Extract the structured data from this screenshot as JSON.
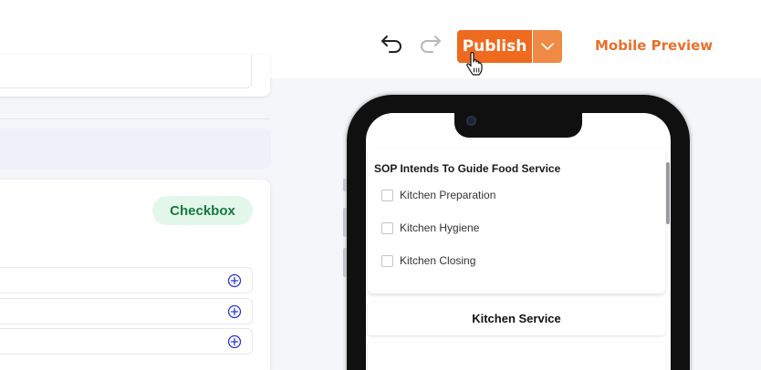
{
  "toolbar": {
    "undo_icon": "undo-icon",
    "redo_icon": "redo-icon",
    "publish_label": "Publish",
    "publish_menu_icon": "chevron-down-icon",
    "mobile_preview_label": "Mobile Preview",
    "publish_color": "#ee6a1f",
    "mobile_preview_color": "#e8702a"
  },
  "editor": {
    "question_type_badge": "Checkbox",
    "badge_color": "#157a3c",
    "option_rows": [
      {
        "add_icon": "add-circle-icon"
      },
      {
        "add_icon": "add-circle-icon"
      },
      {
        "add_icon": "add-circle-icon"
      }
    ]
  },
  "preview": {
    "question_title": "SOP Intends To Guide Food Service",
    "options": [
      {
        "label": "Kitchen Preparation",
        "checked": false
      },
      {
        "label": "Kitchen Hygiene",
        "checked": false
      },
      {
        "label": "Kitchen Closing",
        "checked": false
      }
    ],
    "next_section_title": "Kitchen Service"
  }
}
